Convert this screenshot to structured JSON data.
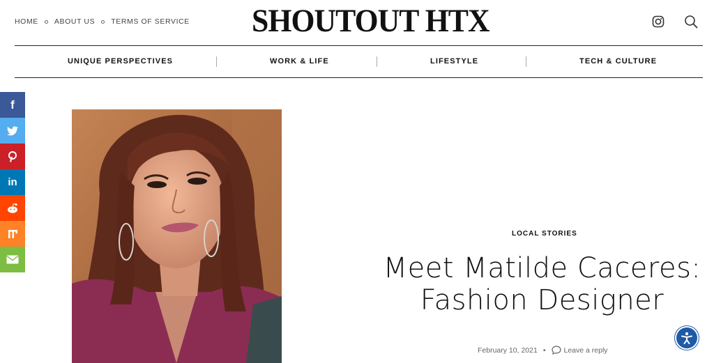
{
  "top_links": {
    "home": "HOME",
    "about": "ABOUT US",
    "terms": "TERMS OF SERVICE"
  },
  "logo": {
    "text": "SHOUTOUT HTX"
  },
  "header_icons": [
    "instagram-icon",
    "search-icon"
  ],
  "nav": {
    "items": [
      "UNIQUE PERSPECTIVES",
      "WORK & LIFE",
      "LIFESTYLE",
      "TECH & CULTURE"
    ]
  },
  "social": {
    "buttons": [
      {
        "name": "facebook",
        "glyph": "f",
        "color": "#3b5998"
      },
      {
        "name": "twitter",
        "glyph": "t",
        "color": "#55acee"
      },
      {
        "name": "pinterest",
        "glyph": "P",
        "color": "#cb2027"
      },
      {
        "name": "linkedin",
        "glyph": "in",
        "color": "#0077b5"
      },
      {
        "name": "reddit",
        "glyph": "r",
        "color": "#ff4500"
      },
      {
        "name": "mix",
        "glyph": "m",
        "color": "#ff8226"
      },
      {
        "name": "email",
        "glyph": "✉",
        "color": "#7cbd42"
      }
    ]
  },
  "article": {
    "category": "LOCAL STORIES",
    "title_line1": "Meet Matilde Caceres:",
    "title_line2": "Fashion Designer",
    "date": "February 10, 2021",
    "separator": "•",
    "comment_label": "Leave a reply"
  },
  "colors": {
    "accessibility": "#1f5aa6",
    "text": "#111111",
    "nav_border": "#222222"
  }
}
